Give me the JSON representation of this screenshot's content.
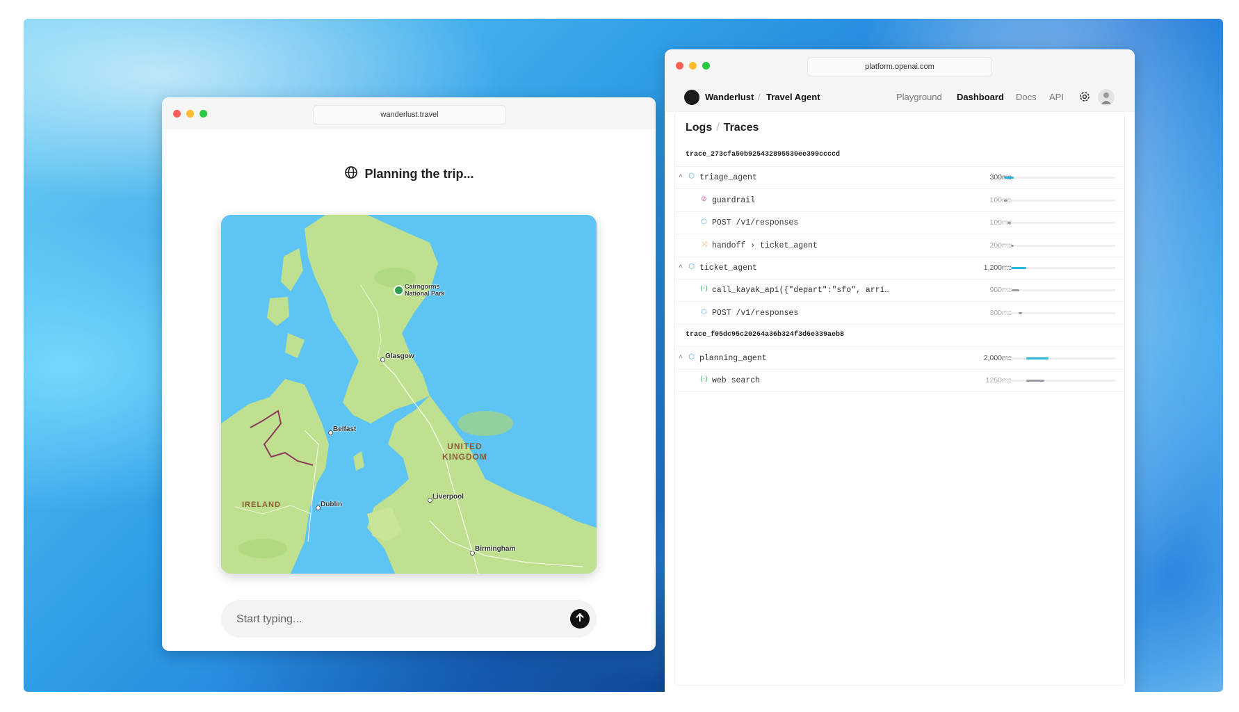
{
  "left_window": {
    "url": "wanderlust.travel",
    "status": "Planning the trip...",
    "map": {
      "places": [
        {
          "name": "Cairngorms National Park",
          "kind": "park"
        },
        {
          "name": "Glasgow",
          "kind": "city"
        },
        {
          "name": "Belfast",
          "kind": "city"
        },
        {
          "name": "Dublin",
          "kind": "city"
        },
        {
          "name": "Liverpool",
          "kind": "city"
        },
        {
          "name": "Birmingham",
          "kind": "city"
        }
      ],
      "country_labels": {
        "uk_line1": "UNITED",
        "uk_line2": "KINGDOM",
        "ireland": "IRELAND"
      },
      "park_line1": "Cairngorms",
      "park_line2": "National Park"
    },
    "input": {
      "placeholder": "Start typing..."
    },
    "icons": {
      "status": "globe-icon",
      "send": "arrow-up-icon"
    }
  },
  "right_window": {
    "url": "platform.openai.com",
    "nav": {
      "org": "Wanderlust",
      "project": "Travel Agent",
      "links": [
        "Playground",
        "Dashboard",
        "Docs",
        "API"
      ],
      "active": "Dashboard"
    },
    "breadcrumb": {
      "section": "Logs",
      "page": "Traces"
    },
    "traces": [
      {
        "id": "trace_273cfa50b925432895530ee399ccccd",
        "spans": [
          {
            "level": 0,
            "icon": "agent",
            "name": "triage_agent",
            "duration": "300ms",
            "start": 0.0,
            "width": 0.09
          },
          {
            "level": 1,
            "icon": "guardrail",
            "name": "guardrail",
            "duration": "100ms",
            "start": 0.0,
            "width": 0.03
          },
          {
            "level": 1,
            "icon": "response",
            "name": "POST /v1/responses",
            "duration": "100ms",
            "start": 0.03,
            "width": 0.03
          },
          {
            "level": 1,
            "icon": "handoff",
            "name": "handoff › ticket_agent",
            "duration": "200ms",
            "start": 0.06,
            "width": 0.03
          },
          {
            "level": 0,
            "icon": "agent",
            "name": "ticket_agent",
            "duration": "1,200ms",
            "start": 0.06,
            "width": 0.14
          },
          {
            "level": 1,
            "icon": "function",
            "name": "call_kayak_api({\"depart\":\"sfo\", arri…",
            "duration": "900ms",
            "start": 0.07,
            "width": 0.07
          },
          {
            "level": 1,
            "icon": "response",
            "name": "POST /v1/responses",
            "duration": "300ms",
            "start": 0.13,
            "width": 0.03
          }
        ]
      },
      {
        "id": "trace_f05dc95c20264a36b324f3d6e339aeb8",
        "spans": [
          {
            "level": 0,
            "icon": "agent",
            "name": "planning_agent",
            "duration": "2,000ms",
            "start": 0.2,
            "width": 0.2
          },
          {
            "level": 1,
            "icon": "function",
            "name": "web search",
            "duration": "1250ms",
            "start": 0.2,
            "width": 0.16
          }
        ]
      }
    ],
    "icons": {
      "settings": "gear-icon",
      "profile": "avatar"
    }
  },
  "colors": {
    "agent_bar": "#2bb7dc",
    "child_bar": "#9a9aa2",
    "agent_icon": "#36a7dd",
    "guardrail_icon": "#d24fb4",
    "response_icon": "#3ea6e0",
    "handoff_icon": "#f09a34",
    "function_icon": "#38b36a"
  }
}
